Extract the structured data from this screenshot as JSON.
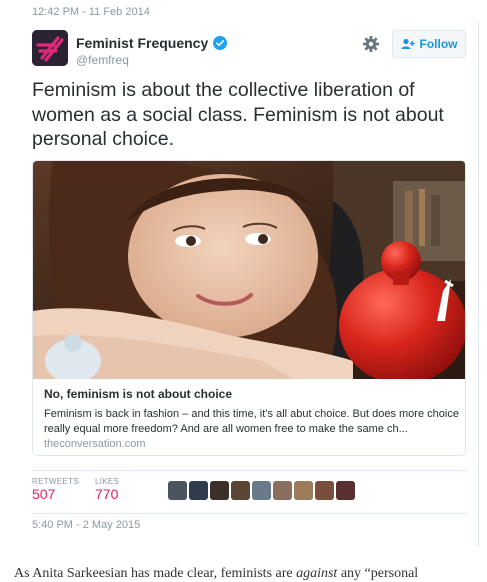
{
  "top_timestamp": "12:42 PM - 11 Feb 2014",
  "tweet": {
    "display_name": "Feminist Frequency",
    "handle": "@femfreq",
    "follow_label": "Follow",
    "text": "Feminism is about the collective liberation of women as a social class. Feminism is not about personal choice.",
    "card": {
      "title": "No, feminism is not about choice",
      "description": "Feminism is back in fashion – and this time, it’s all abut choice. But does more choice really equal more freedom? And are all women free to make the same ch...",
      "domain": "theconversation.com"
    },
    "stats": {
      "retweets_label": "RETWEETS",
      "retweets_value": "507",
      "likes_label": "LIKES",
      "likes_value": "770"
    },
    "timestamp": "5:40 PM - 2 May 2015"
  },
  "liker_colors": [
    "#4a5560",
    "#2e3c4e",
    "#3b3029",
    "#5b4636",
    "#6a7a8a",
    "#8a6f5c",
    "#9b7b58",
    "#7a4e3a",
    "#5a2f2f"
  ],
  "article_excerpt": "As Anita Sarkeesian has made clear, feminists are against any “personal",
  "colors": {
    "accent": "#1b95e0",
    "like_count": "#e0245e",
    "muted": "#8899a6"
  }
}
